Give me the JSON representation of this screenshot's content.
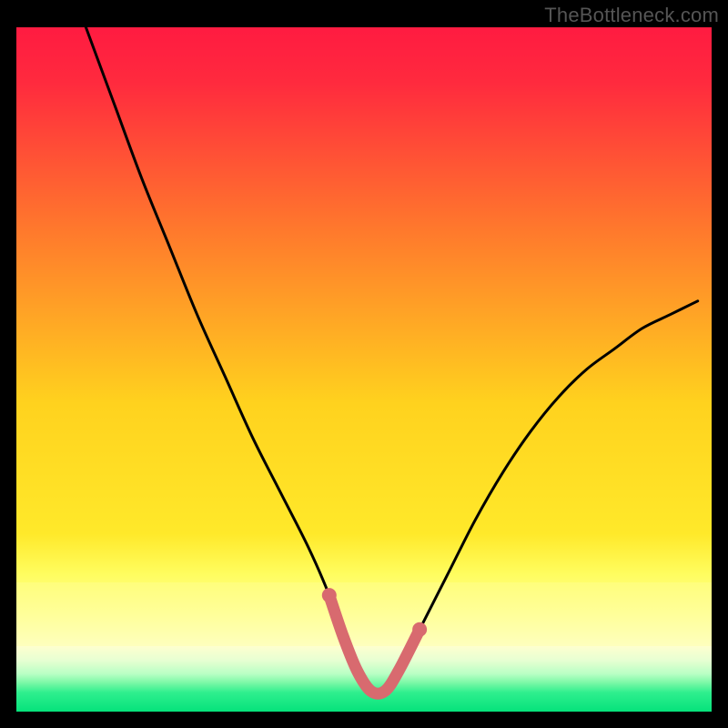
{
  "watermark": "TheBottleneck.com",
  "chart_data": {
    "type": "line",
    "title": "",
    "xlabel": "",
    "ylabel": "",
    "xlim": [
      0,
      100
    ],
    "ylim": [
      0,
      100
    ],
    "grid": false,
    "legend": false,
    "background_gradient": {
      "top_color": "#ff1b41",
      "mid_color": "#ffe323",
      "deep_color": "#ffff78",
      "bottom_color": "#05e27b"
    },
    "series": [
      {
        "name": "bottleneck-curve",
        "color": "#000000",
        "x": [
          10,
          14,
          18,
          22,
          26,
          30,
          34,
          38,
          42,
          45,
          47,
          49,
          51,
          53,
          55,
          58,
          62,
          66,
          70,
          74,
          78,
          82,
          86,
          90,
          94,
          98
        ],
        "y": [
          100,
          89,
          78,
          68,
          58,
          49,
          40,
          32,
          24,
          17,
          11,
          6,
          3,
          3,
          6,
          12,
          20,
          28,
          35,
          41,
          46,
          50,
          53,
          56,
          58,
          60
        ]
      },
      {
        "name": "highlight-trough",
        "color": "#d86a6f",
        "x": [
          45,
          47,
          49,
          51,
          53,
          55,
          58
        ],
        "y": [
          17,
          11,
          6,
          3,
          3,
          6,
          12
        ]
      }
    ]
  }
}
